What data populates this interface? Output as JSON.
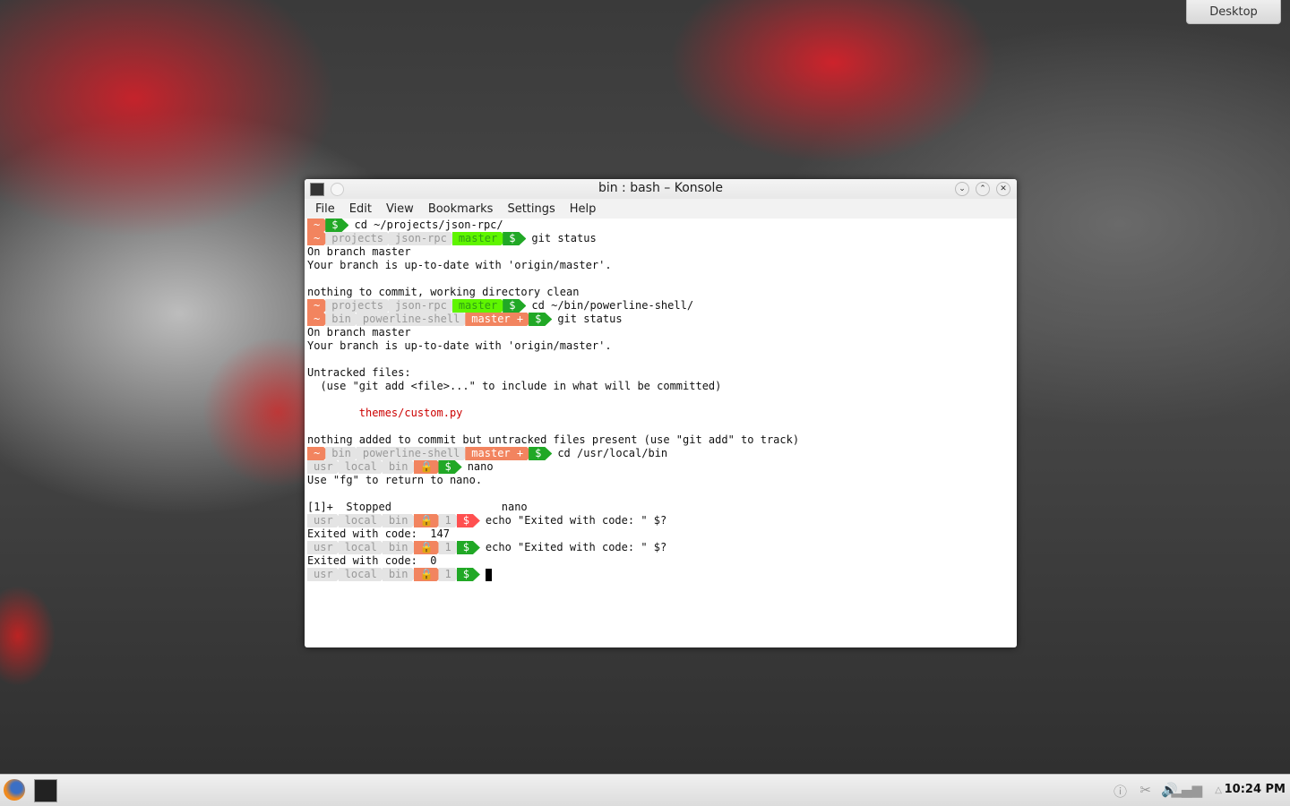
{
  "desktop_button": "Desktop",
  "window": {
    "title": "bin : bash – Konsole"
  },
  "menu": [
    "File",
    "Edit",
    "View",
    "Bookmarks",
    "Settings",
    "Help"
  ],
  "colors": {
    "tilde": "#f2845f",
    "path": "#e4e4e4",
    "path_fg": "#999999",
    "green": "#21a826",
    "lime": "#5ff500",
    "lime_fg": "#2f9e14",
    "salmon": "#f2845f",
    "red": "#ff5050",
    "white": "#ffffff"
  },
  "lines": [
    {
      "segs": [
        [
          "~",
          "tilde"
        ],
        [
          "$",
          "green"
        ]
      ],
      "cmd": "cd ~/projects/json-rpc/"
    },
    {
      "segs": [
        [
          "~",
          "tilde"
        ],
        [
          "projects",
          "path"
        ],
        [
          "json-rpc",
          "path"
        ],
        [
          "master",
          "lime"
        ],
        [
          "$",
          "green"
        ]
      ],
      "cmd": "git status"
    },
    {
      "text": "On branch master"
    },
    {
      "text": "Your branch is up-to-date with 'origin/master'."
    },
    {
      "text": ""
    },
    {
      "text": "nothing to commit, working directory clean"
    },
    {
      "segs": [
        [
          "~",
          "tilde"
        ],
        [
          "projects",
          "path"
        ],
        [
          "json-rpc",
          "path"
        ],
        [
          "master",
          "lime"
        ],
        [
          "$",
          "green"
        ]
      ],
      "cmd": "cd ~/bin/powerline-shell/"
    },
    {
      "segs": [
        [
          "~",
          "tilde"
        ],
        [
          "bin",
          "path"
        ],
        [
          "powerline-shell",
          "path"
        ],
        [
          "master +",
          "salmon"
        ],
        [
          "$",
          "green"
        ]
      ],
      "cmd": "git status"
    },
    {
      "text": "On branch master"
    },
    {
      "text": "Your branch is up-to-date with 'origin/master'."
    },
    {
      "text": ""
    },
    {
      "text": "Untracked files:"
    },
    {
      "text": "  (use \"git add <file>...\" to include in what will be committed)"
    },
    {
      "text": ""
    },
    {
      "text": "        themes/custom.py",
      "red": true
    },
    {
      "text": ""
    },
    {
      "text": "nothing added to commit but untracked files present (use \"git add\" to track)"
    },
    {
      "segs": [
        [
          "~",
          "tilde"
        ],
        [
          "bin",
          "path"
        ],
        [
          "powerline-shell",
          "path"
        ],
        [
          "master +",
          "salmon"
        ],
        [
          "$",
          "green"
        ]
      ],
      "cmd": "cd /usr/local/bin"
    },
    {
      "segs": [
        [
          "usr",
          "path"
        ],
        [
          "local",
          "path"
        ],
        [
          "bin",
          "path"
        ],
        [
          "🔒",
          "salmon"
        ],
        [
          "$",
          "green"
        ]
      ],
      "cmd": "nano"
    },
    {
      "text": "Use \"fg\" to return to nano."
    },
    {
      "text": ""
    },
    {
      "text": "[1]+  Stopped                 nano"
    },
    {
      "segs": [
        [
          "usr",
          "path"
        ],
        [
          "local",
          "path"
        ],
        [
          "bin",
          "path"
        ],
        [
          "🔒",
          "salmon"
        ],
        [
          "1",
          "path"
        ],
        [
          "$",
          "red"
        ]
      ],
      "cmd": "echo \"Exited with code: \" $?"
    },
    {
      "text": "Exited with code:  147"
    },
    {
      "segs": [
        [
          "usr",
          "path"
        ],
        [
          "local",
          "path"
        ],
        [
          "bin",
          "path"
        ],
        [
          "🔒",
          "salmon"
        ],
        [
          "1",
          "path"
        ],
        [
          "$",
          "green"
        ]
      ],
      "cmd": "echo \"Exited with code: \" $?"
    },
    {
      "text": "Exited with code:  0"
    },
    {
      "segs": [
        [
          "usr",
          "path"
        ],
        [
          "local",
          "path"
        ],
        [
          "bin",
          "path"
        ],
        [
          "🔒",
          "salmon"
        ],
        [
          "1",
          "path"
        ],
        [
          "$",
          "green"
        ]
      ],
      "cmd": "",
      "cursor": true
    }
  ],
  "clock": "10:24 PM",
  "tray": [
    "info-icon",
    "klipper-scissors-icon",
    "volume-icon",
    "network-signal-icon",
    "expand-tray-icon"
  ]
}
